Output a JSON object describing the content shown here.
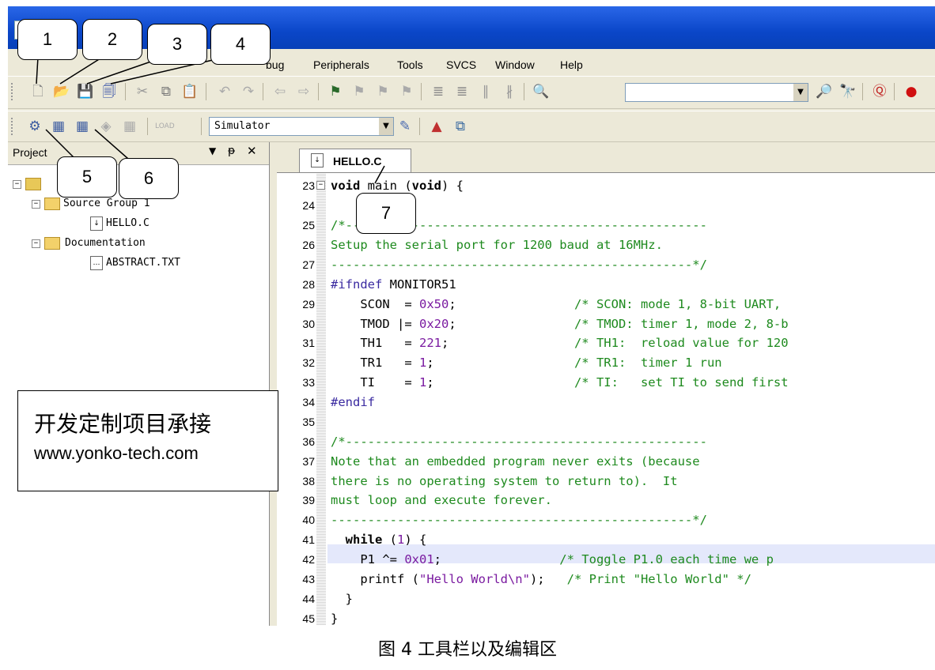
{
  "menu": {
    "items": [
      "bug",
      "Peripherals",
      "Tools",
      "SVCS",
      "Window",
      "Help"
    ]
  },
  "toolbar2": {
    "target_combo": "Simulator"
  },
  "project": {
    "title": "Project",
    "tree": {
      "group": "Source Group 1",
      "file_c": "HELLO.C",
      "docs": "Documentation",
      "file_txt": "ABSTRACT.TXT"
    }
  },
  "editor": {
    "tab": "HELLO.C",
    "lines": [
      "23",
      "24",
      "25",
      "26",
      "27",
      "28",
      "29",
      "30",
      "31",
      "32",
      "33",
      "34",
      "35",
      "36",
      "37",
      "38",
      "39",
      "40",
      "41",
      "42",
      "43",
      "44",
      "45"
    ],
    "code": {
      "l23a": "void",
      "l23b": " main (",
      "l23c": "void",
      "l23d": ") {",
      "l25": "/*-------------------------------------------------",
      "l26": "Setup the serial port for 1200 baud at 16MHz.",
      "l27": "-------------------------------------------------*/",
      "l28a": "#ifndef",
      "l28b": " MONITOR51",
      "l29a": "    SCON  = ",
      "l29b": "0x50",
      "l29c": ";",
      "l29d": "                /* SCON: mode 1, 8-bit UART,",
      "l30a": "    TMOD |= ",
      "l30b": "0x20",
      "l30c": ";",
      "l30d": "                /* TMOD: timer 1, mode 2, 8-b",
      "l31a": "    TH1   = ",
      "l31b": "221",
      "l31c": ";",
      "l31d": "                 /* TH1:  reload value for 120",
      "l32a": "    TR1   = ",
      "l32b": "1",
      "l32c": ";",
      "l32d": "                   /* TR1:  timer 1 run",
      "l33a": "    TI    = ",
      "l33b": "1",
      "l33c": ";",
      "l33d": "                   /* TI:   set TI to send first",
      "l34": "#endif",
      "l36": "/*-------------------------------------------------",
      "l37": "Note that an embedded program never exits (because",
      "l38": "there is no operating system to return to).  It",
      "l39": "must loop and execute forever.",
      "l40": "-------------------------------------------------*/",
      "l41a": "  ",
      "l41b": "while",
      "l41c": " (",
      "l41d": "1",
      "l41e": ") {",
      "l42a": "    P1 ^= ",
      "l42b": "0x01",
      "l42c": ";",
      "l42d": "                /* Toggle P1.0 each time we p",
      "l43a": "    printf (",
      "l43b": "\"Hello World\\n\"",
      "l43c": ");",
      "l43d": "   /* Print \"Hello World\" */",
      "l44": "  }",
      "l45": "}"
    }
  },
  "callouts": [
    "1",
    "2",
    "3",
    "4",
    "5",
    "6",
    "7"
  ],
  "ad": {
    "line1": "开发定制项目承接",
    "line2": "www.yonko-tech.com"
  },
  "caption": "图 4 工具栏以及编辑区"
}
